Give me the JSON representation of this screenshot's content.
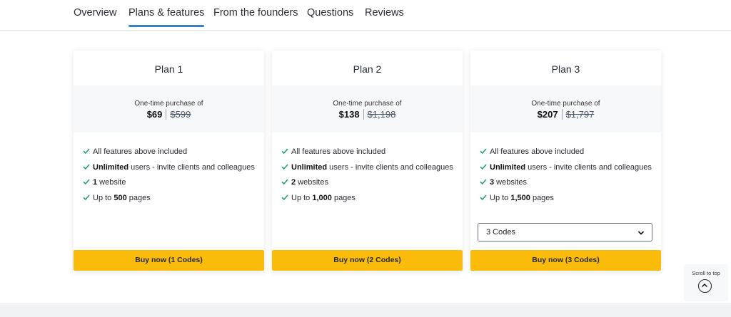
{
  "nav": {
    "tabs": [
      {
        "label": "Overview"
      },
      {
        "label": "Plans & features"
      },
      {
        "label": "From the founders"
      },
      {
        "label": "Questions"
      },
      {
        "label": "Reviews"
      }
    ],
    "active_tab": "Plans & features"
  },
  "plans": [
    {
      "title": "Plan 1",
      "purchase_label": "One-time purchase of",
      "price": "$69",
      "original_price": "$599",
      "features": [
        {
          "bold": "",
          "text": "All features above included"
        },
        {
          "bold": "Unlimited",
          "text": " users - invite clients and colleagues"
        },
        {
          "bold": "1",
          "text": " website"
        },
        {
          "pre": "Up to ",
          "bold": "500",
          "text": " pages"
        }
      ],
      "button": "Buy now (1 Codes)"
    },
    {
      "title": "Plan 2",
      "purchase_label": "One-time purchase of",
      "price": "$138",
      "original_price": "$1,198",
      "features": [
        {
          "bold": "",
          "text": "All features above included"
        },
        {
          "bold": "Unlimited",
          "text": " users - invite clients and colleagues"
        },
        {
          "bold": "2",
          "text": " websites"
        },
        {
          "pre": "Up to ",
          "bold": "1,000",
          "text": " pages"
        }
      ],
      "button": "Buy now (2 Codes)"
    },
    {
      "title": "Plan 3",
      "purchase_label": "One-time purchase of",
      "price": "$207",
      "original_price": "$1,797",
      "features": [
        {
          "bold": "",
          "text": "All features above included"
        },
        {
          "bold": "Unlimited",
          "text": " users - invite clients and colleagues"
        },
        {
          "bold": "3",
          "text": " websites"
        },
        {
          "pre": "Up to ",
          "bold": "1,500",
          "text": " pages"
        }
      ],
      "codes_select": "3 Codes",
      "button": "Buy now (3 Codes)"
    }
  ],
  "scroll_top": {
    "label": "Scroll to top",
    "icon": "chevron-up-icon"
  },
  "colors": {
    "accent": "#3b82c4",
    "button": "#fbbb0a",
    "check": "#22a06b"
  },
  "icons": {
    "feature": "check-icon",
    "select": "chevron-down-icon"
  }
}
